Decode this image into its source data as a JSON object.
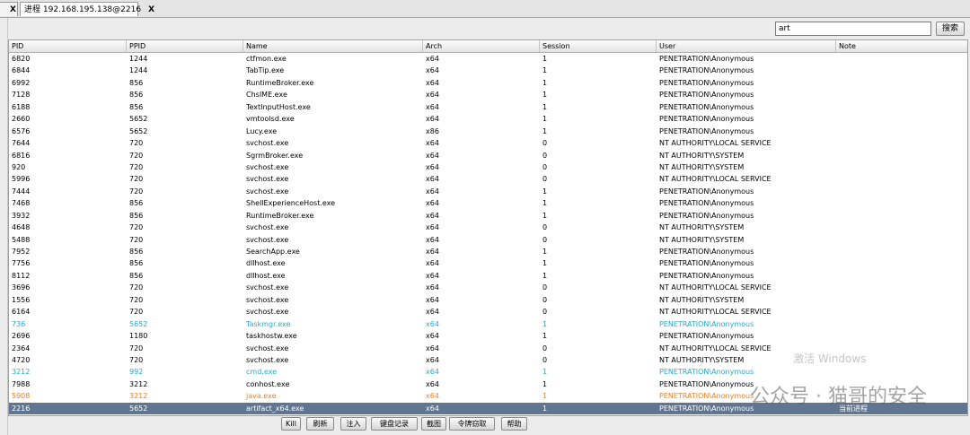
{
  "tabs": [
    {
      "label": "",
      "close": "X"
    },
    {
      "label": "进程 192.168.195.138@2216",
      "close": "X"
    }
  ],
  "search": {
    "value": "art",
    "button": "搜索"
  },
  "columns": [
    "PID",
    "PPID",
    "Name",
    "Arch",
    "Session",
    "User",
    "Note"
  ],
  "rows": [
    {
      "pid": "6820",
      "ppid": "1244",
      "name": "ctfmon.exe",
      "arch": "x64",
      "session": "1",
      "user": "PENETRATION\\Anonymous",
      "note": ""
    },
    {
      "pid": "6844",
      "ppid": "1244",
      "name": "TabTip.exe",
      "arch": "x64",
      "session": "1",
      "user": "PENETRATION\\Anonymous",
      "note": ""
    },
    {
      "pid": "6992",
      "ppid": "856",
      "name": "RuntimeBroker.exe",
      "arch": "x64",
      "session": "1",
      "user": "PENETRATION\\Anonymous",
      "note": ""
    },
    {
      "pid": "7128",
      "ppid": "856",
      "name": "ChsIME.exe",
      "arch": "x64",
      "session": "1",
      "user": "PENETRATION\\Anonymous",
      "note": ""
    },
    {
      "pid": "6188",
      "ppid": "856",
      "name": "TextInputHost.exe",
      "arch": "x64",
      "session": "1",
      "user": "PENETRATION\\Anonymous",
      "note": ""
    },
    {
      "pid": "2660",
      "ppid": "5652",
      "name": "vmtoolsd.exe",
      "arch": "x64",
      "session": "1",
      "user": "PENETRATION\\Anonymous",
      "note": ""
    },
    {
      "pid": "6576",
      "ppid": "5652",
      "name": "Lucy.exe",
      "arch": "x86",
      "session": "1",
      "user": "PENETRATION\\Anonymous",
      "note": ""
    },
    {
      "pid": "7644",
      "ppid": "720",
      "name": "svchost.exe",
      "arch": "x64",
      "session": "0",
      "user": "NT AUTHORITY\\LOCAL SERVICE",
      "note": ""
    },
    {
      "pid": "6816",
      "ppid": "720",
      "name": "SgrmBroker.exe",
      "arch": "x64",
      "session": "0",
      "user": "NT AUTHORITY\\SYSTEM",
      "note": ""
    },
    {
      "pid": "920",
      "ppid": "720",
      "name": "svchost.exe",
      "arch": "x64",
      "session": "0",
      "user": "NT AUTHORITY\\SYSTEM",
      "note": ""
    },
    {
      "pid": "5996",
      "ppid": "720",
      "name": "svchost.exe",
      "arch": "x64",
      "session": "0",
      "user": "NT AUTHORITY\\LOCAL SERVICE",
      "note": ""
    },
    {
      "pid": "7444",
      "ppid": "720",
      "name": "svchost.exe",
      "arch": "x64",
      "session": "1",
      "user": "PENETRATION\\Anonymous",
      "note": ""
    },
    {
      "pid": "7468",
      "ppid": "856",
      "name": "ShellExperienceHost.exe",
      "arch": "x64",
      "session": "1",
      "user": "PENETRATION\\Anonymous",
      "note": ""
    },
    {
      "pid": "3932",
      "ppid": "856",
      "name": "RuntimeBroker.exe",
      "arch": "x64",
      "session": "1",
      "user": "PENETRATION\\Anonymous",
      "note": ""
    },
    {
      "pid": "4648",
      "ppid": "720",
      "name": "svchost.exe",
      "arch": "x64",
      "session": "0",
      "user": "NT AUTHORITY\\SYSTEM",
      "note": ""
    },
    {
      "pid": "5488",
      "ppid": "720",
      "name": "svchost.exe",
      "arch": "x64",
      "session": "0",
      "user": "NT AUTHORITY\\SYSTEM",
      "note": ""
    },
    {
      "pid": "7952",
      "ppid": "856",
      "name": "SearchApp.exe",
      "arch": "x64",
      "session": "1",
      "user": "PENETRATION\\Anonymous",
      "note": ""
    },
    {
      "pid": "7756",
      "ppid": "856",
      "name": "dllhost.exe",
      "arch": "x64",
      "session": "1",
      "user": "PENETRATION\\Anonymous",
      "note": ""
    },
    {
      "pid": "8112",
      "ppid": "856",
      "name": "dllhost.exe",
      "arch": "x64",
      "session": "1",
      "user": "PENETRATION\\Anonymous",
      "note": ""
    },
    {
      "pid": "3696",
      "ppid": "720",
      "name": "svchost.exe",
      "arch": "x64",
      "session": "0",
      "user": "NT AUTHORITY\\LOCAL SERVICE",
      "note": ""
    },
    {
      "pid": "1556",
      "ppid": "720",
      "name": "svchost.exe",
      "arch": "x64",
      "session": "0",
      "user": "NT AUTHORITY\\SYSTEM",
      "note": ""
    },
    {
      "pid": "6164",
      "ppid": "720",
      "name": "svchost.exe",
      "arch": "x64",
      "session": "0",
      "user": "NT AUTHORITY\\LOCAL SERVICE",
      "note": ""
    },
    {
      "pid": "736",
      "ppid": "5652",
      "name": "Taskmgr.exe",
      "arch": "x64",
      "session": "1",
      "user": "PENETRATION\\Anonymous",
      "note": "",
      "style": "cyan"
    },
    {
      "pid": "2696",
      "ppid": "1180",
      "name": "taskhostw.exe",
      "arch": "x64",
      "session": "1",
      "user": "PENETRATION\\Anonymous",
      "note": ""
    },
    {
      "pid": "2364",
      "ppid": "720",
      "name": "svchost.exe",
      "arch": "x64",
      "session": "0",
      "user": "NT AUTHORITY\\LOCAL SERVICE",
      "note": ""
    },
    {
      "pid": "4720",
      "ppid": "720",
      "name": "svchost.exe",
      "arch": "x64",
      "session": "0",
      "user": "NT AUTHORITY\\SYSTEM",
      "note": ""
    },
    {
      "pid": "3212",
      "ppid": "992",
      "name": "cmd.exe",
      "arch": "x64",
      "session": "1",
      "user": "PENETRATION\\Anonymous",
      "note": "",
      "style": "cyan"
    },
    {
      "pid": "7988",
      "ppid": "3212",
      "name": "conhost.exe",
      "arch": "x64",
      "session": "1",
      "user": "PENETRATION\\Anonymous",
      "note": ""
    },
    {
      "pid": "5908",
      "ppid": "3212",
      "name": "java.exe",
      "arch": "x64",
      "session": "1",
      "user": "PENETRATION\\Anonymous",
      "note": "",
      "style": "orange"
    },
    {
      "pid": "2216",
      "ppid": "5652",
      "name": "artifact_x64.exe",
      "arch": "x64",
      "session": "1",
      "user": "PENETRATION\\Anonymous",
      "note": "当前进程",
      "style": "sel"
    }
  ],
  "buttons": [
    "Kill",
    "刷新",
    "注入",
    "键盘记录",
    "截图",
    "令牌窃取",
    "帮助"
  ],
  "overlay": {
    "watermark": "公众号 · 猫哥的安全",
    "activate": "激活 Windows"
  },
  "colors": {
    "selected_row": "#5f7592",
    "cyan": "#2aa7c9",
    "orange": "#e8822b"
  }
}
